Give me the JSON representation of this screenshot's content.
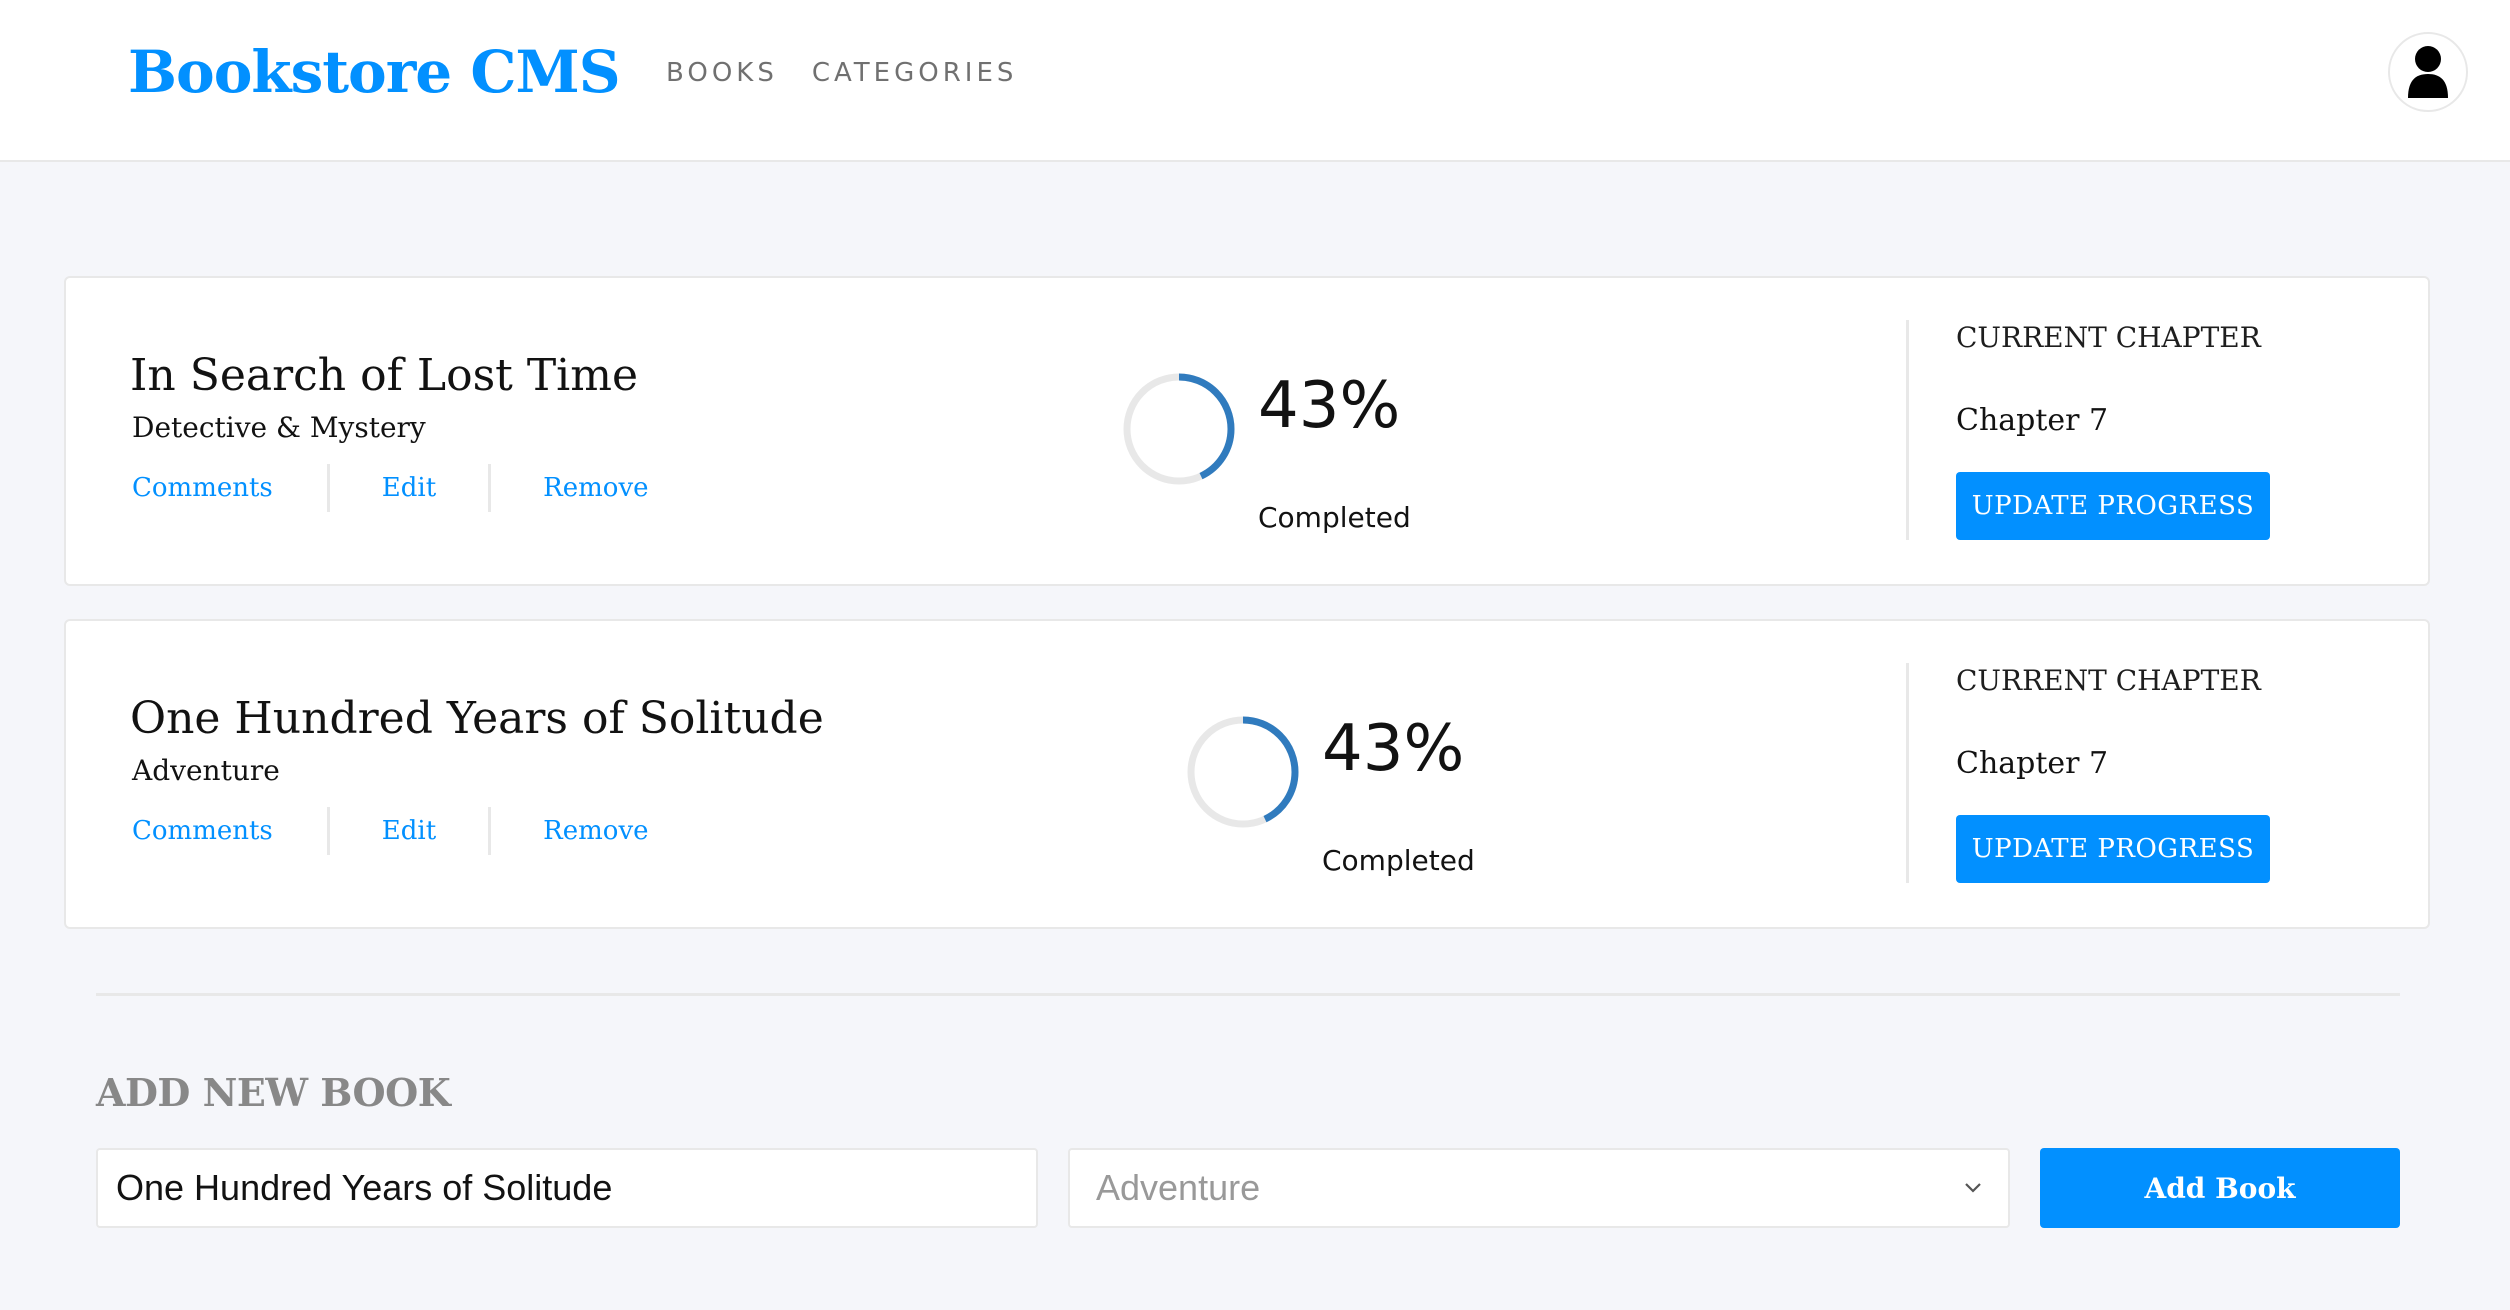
{
  "header": {
    "logo": "Bookstore CMS",
    "nav": [
      "BOOKS",
      "CATEGORIES"
    ],
    "avatar_icon": "user-icon"
  },
  "books": [
    {
      "title": "In Search of Lost Time",
      "category": "Detective & Mystery",
      "actions": {
        "comments": "Comments",
        "edit": "Edit",
        "remove": "Remove"
      },
      "progress_percent": 43,
      "progress_text": "43%",
      "progress_label": "Completed",
      "chapter_heading": "CURRENT CHAPTER",
      "chapter": "Chapter 7",
      "update_label": "UPDATE PROGRESS"
    },
    {
      "title": "One Hundred Years of Solitude",
      "category": "Adventure",
      "actions": {
        "comments": "Comments",
        "edit": "Edit",
        "remove": "Remove"
      },
      "progress_percent": 43,
      "progress_text": "43%",
      "progress_label": "Completed",
      "chapter_heading": "CURRENT CHAPTER",
      "chapter": "Chapter 7",
      "update_label": "UPDATE PROGRESS"
    }
  ],
  "form": {
    "heading": "ADD NEW BOOK",
    "title_value": "One Hundred Years of Solitude",
    "category_value": "Adventure",
    "dropdown_icon": "chevron-down-icon",
    "submit_label": "Add Book"
  },
  "colors": {
    "accent": "#0290ff",
    "progress": "#307bbe",
    "track": "#e8e8e8",
    "background": "#f5f6fa"
  }
}
